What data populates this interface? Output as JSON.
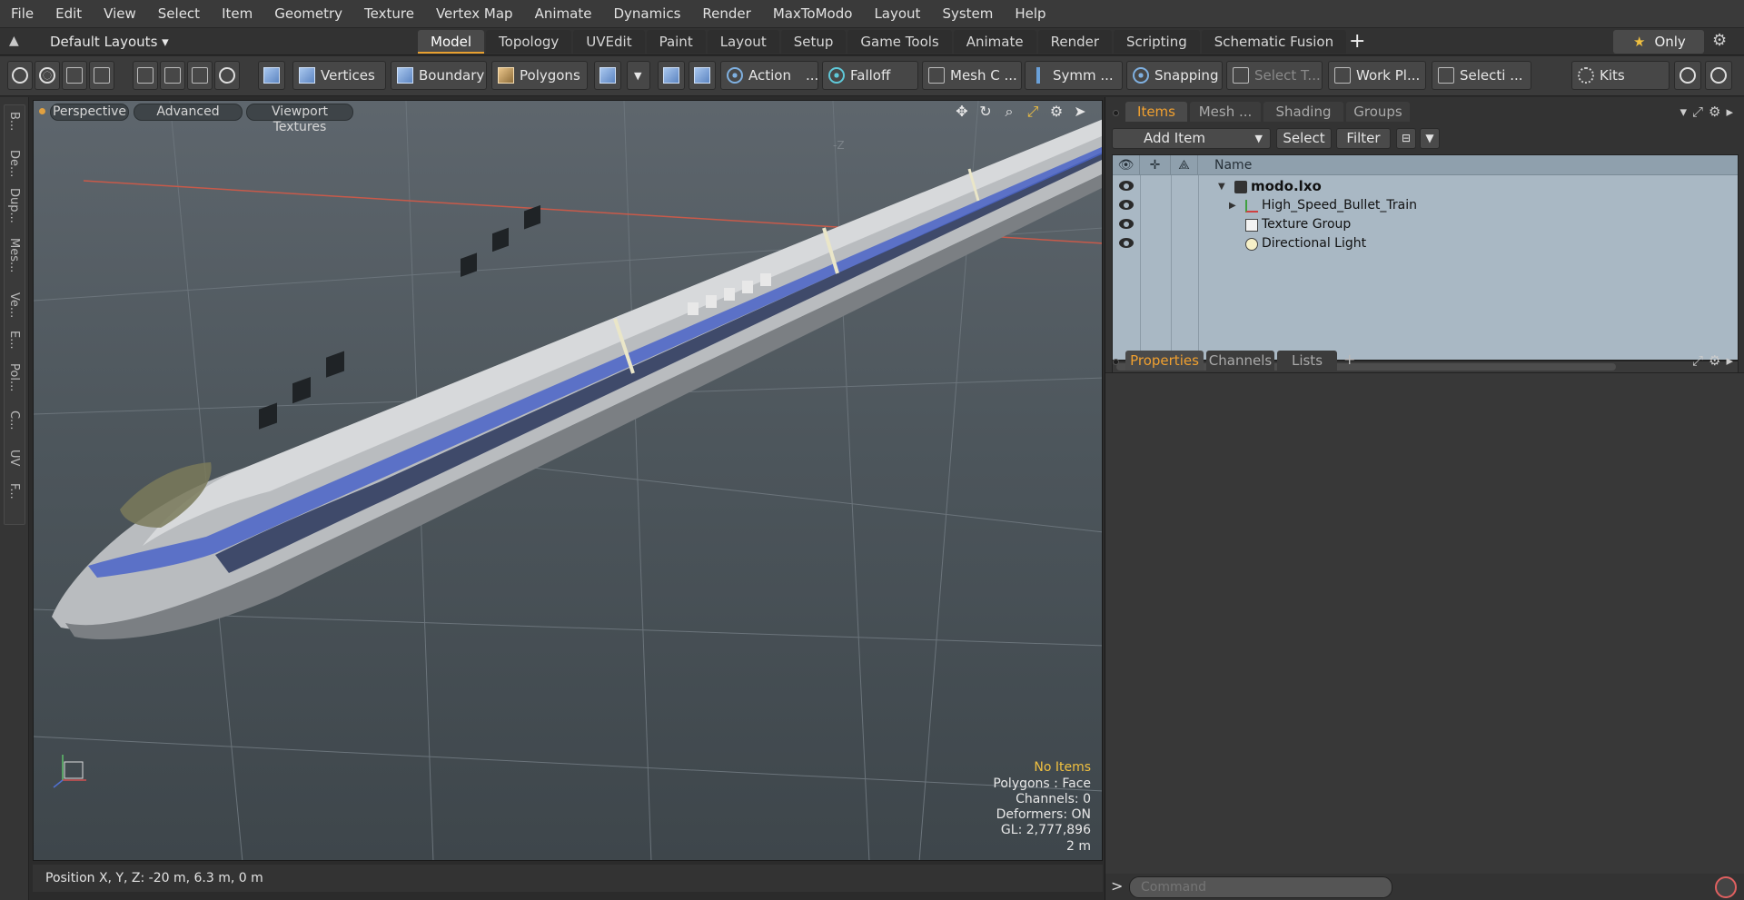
{
  "menu": [
    "File",
    "Edit",
    "View",
    "Select",
    "Item",
    "Geometry",
    "Texture",
    "Vertex Map",
    "Animate",
    "Dynamics",
    "Render",
    "MaxToModo",
    "Layout",
    "System",
    "Help"
  ],
  "layout_selector": "Default Layouts ▾",
  "layout_tabs": [
    "Model",
    "Topology",
    "UVEdit",
    "Paint",
    "Layout",
    "Setup",
    "Game Tools",
    "Animate",
    "Render",
    "Scripting",
    "Schematic Fusion"
  ],
  "active_layout_tab": "Model",
  "only_label": "Only",
  "toolbar": {
    "vertices": "Vertices",
    "boundary": "Boundary",
    "polygons": "Polygons",
    "action": "Action",
    "action_more": "...",
    "falloff": "Falloff",
    "mesh_constraint": "Mesh C ...",
    "symmetry": "Symm ...",
    "snapping": "Snapping",
    "select_through": "Select T...",
    "work_plane": "Work Pl...",
    "selection_sets": "Selecti ...",
    "kits": "Kits"
  },
  "left_strip": [
    "B...",
    "De...",
    "Dup...",
    "Mes...",
    "Ve...",
    "E...",
    "Pol...",
    "C...",
    "UV",
    "F..."
  ],
  "viewport": {
    "view_mode": "Perspective",
    "shading": "Advanced",
    "textures": "Viewport Textures",
    "axis_hint": "-Z",
    "stats": {
      "no_items": "No Items",
      "polygons": "Polygons : Face",
      "channels": "Channels: 0",
      "deformers": "Deformers: ON",
      "gl": "GL: 2,777,896",
      "grid": "2 m"
    }
  },
  "status": {
    "position": "Position X, Y, Z:   -20 m, 6.3 m, 0 m"
  },
  "items_panel": {
    "tabs": [
      "Items",
      "Mesh ...",
      "Shading",
      "Groups"
    ],
    "active_tab": "Items",
    "add_item": "Add Item",
    "select": "Select",
    "filter": "Filter",
    "name_col": "Name",
    "rows": [
      {
        "label": "modo.lxo"
      },
      {
        "label": "High_Speed_Bullet_Train"
      },
      {
        "label": "Texture Group"
      },
      {
        "label": "Directional Light"
      }
    ]
  },
  "properties_panel": {
    "tabs": [
      "Properties",
      "Channels",
      "Lists"
    ],
    "active_tab": "Properties"
  },
  "command": {
    "placeholder": "Command"
  },
  "colors": {
    "accent": "#e8a030",
    "stats_highlight": "#f0c040",
    "tree_bg": "#a9b8c4"
  }
}
